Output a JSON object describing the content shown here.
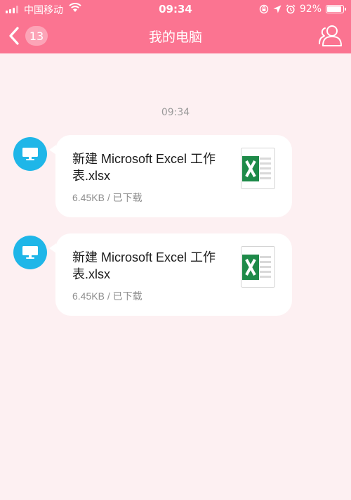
{
  "status_bar": {
    "carrier": "中国移动",
    "time": "09:34",
    "battery_percent": "92%",
    "battery_level": 0.92,
    "icons": [
      "signal-icon",
      "wifi-icon",
      "screen-rotation-lock-icon",
      "location-icon",
      "alarm-icon",
      "battery-icon"
    ]
  },
  "nav": {
    "back_icon": "chevron-left-icon",
    "unread_count": "13",
    "title": "我的电脑",
    "profile_icon": "user-profile-icon"
  },
  "chat": {
    "timestamp": "09:34",
    "messages": [
      {
        "avatar_icon": "computer-icon",
        "file_name": "新建 Microsoft Excel 工作表.xlsx",
        "file_meta": "6.45KB / 已下载",
        "file_icon": "excel-file-icon"
      },
      {
        "avatar_icon": "computer-icon",
        "file_name": "新建 Microsoft Excel 工作表.xlsx",
        "file_meta": "6.45KB / 已下载",
        "file_icon": "excel-file-icon"
      }
    ]
  },
  "colors": {
    "header": "#fb7491",
    "background": "#fdf0f2",
    "avatar": "#1fb6e8",
    "excel_green": "#1e8a49",
    "bubble": "#ffffff"
  }
}
